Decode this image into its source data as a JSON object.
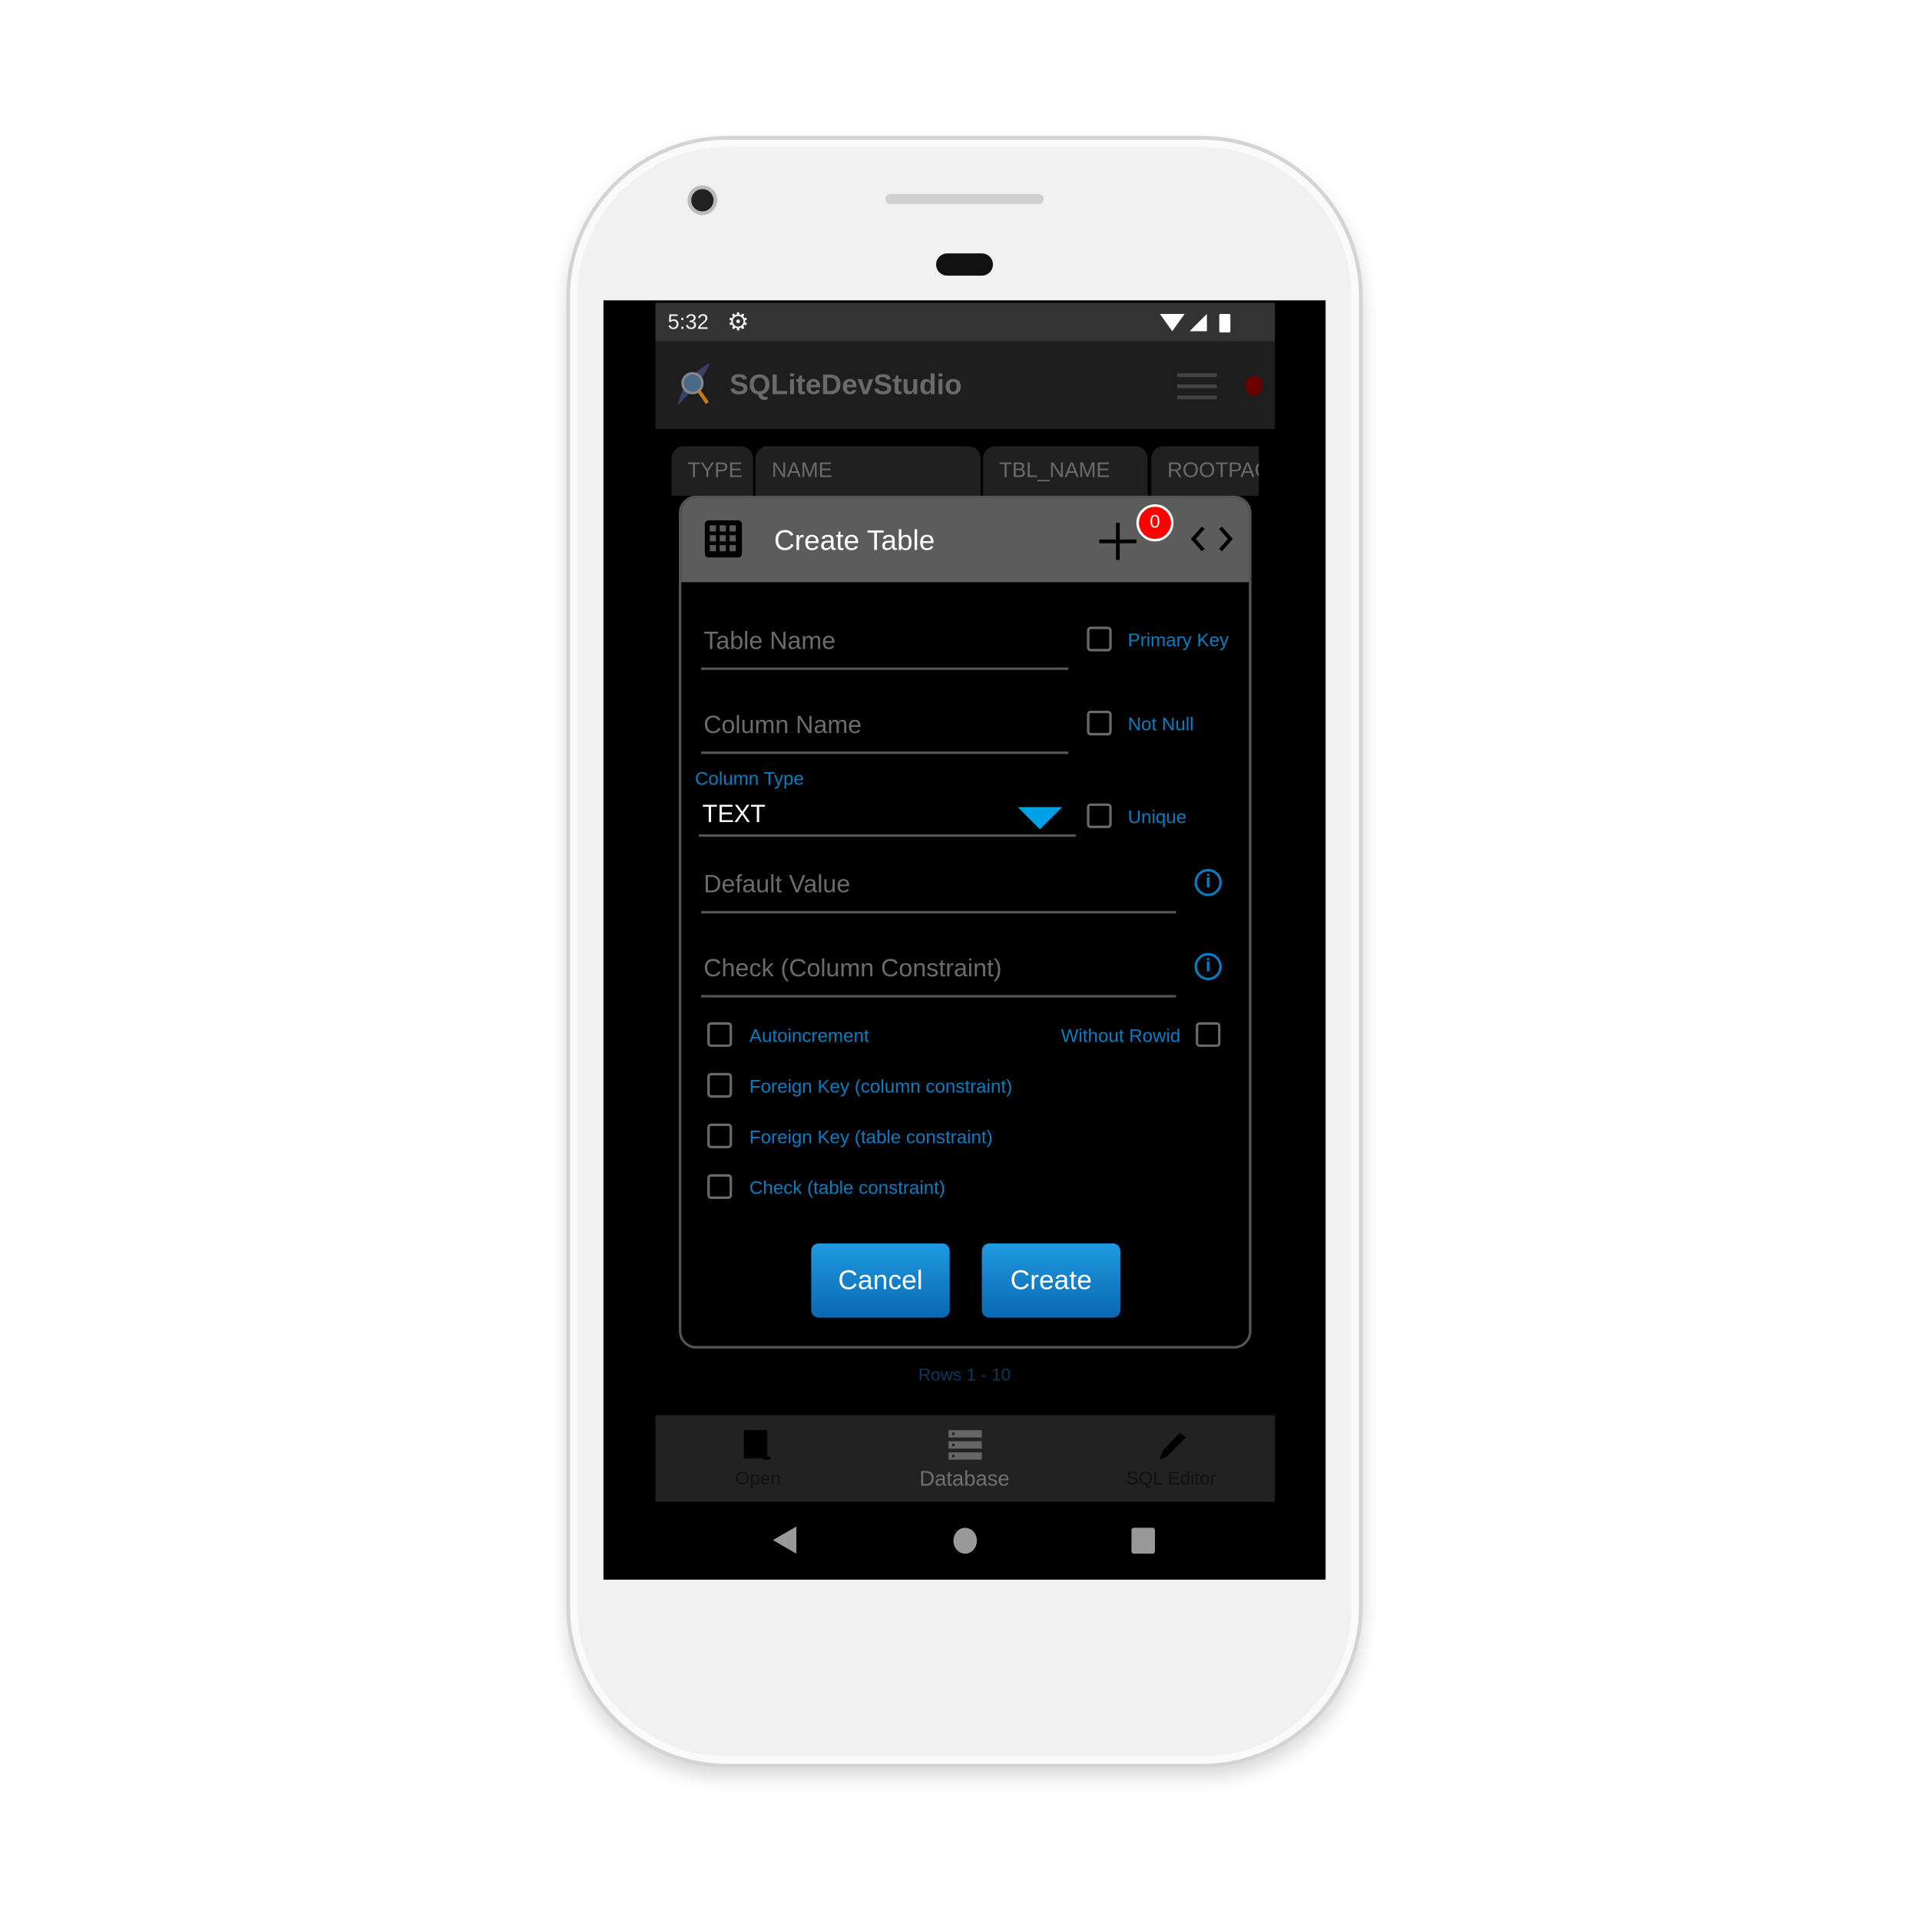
{
  "status_bar": {
    "time": "5:32",
    "icons": [
      "gear-icon",
      "wifi-icon",
      "signal-icon",
      "battery-icon"
    ]
  },
  "app_bar": {
    "title": "SQLiteDevStudio",
    "menu_icon": "hamburger-icon"
  },
  "table_columns": [
    "TYPE",
    "NAME",
    "TBL_NAME",
    "ROOTPAG"
  ],
  "dialog": {
    "title": "Create Table",
    "badge_count": "0",
    "fields": {
      "table_name_placeholder": "Table Name",
      "column_name_placeholder": "Column Name",
      "column_type_label": "Column Type",
      "column_type_value": "TEXT",
      "default_value_placeholder": "Default Value",
      "check_placeholder": "Check (Column Constraint)"
    },
    "checkboxes": {
      "primary_key": "Primary Key",
      "not_null": "Not Null",
      "unique": "Unique",
      "autoincrement": "Autoincrement",
      "without_rowid": "Without Rowid",
      "fk_column": "Foreign Key (column constraint)",
      "fk_table": "Foreign Key (table constraint)",
      "check_table": "Check (table constraint)"
    },
    "cancel_label": "Cancel",
    "create_label": "Create"
  },
  "rows_label": "Rows 1 - 10",
  "bottom_nav": [
    {
      "label": "Open",
      "icon": "door-icon"
    },
    {
      "label": "Database",
      "icon": "database-icon",
      "active": true
    },
    {
      "label": "SQL Editor",
      "icon": "pencil-icon"
    }
  ],
  "colors": {
    "accent": "#0a7cc0",
    "button": "#1a86d0",
    "badge": "#ff0000",
    "dropdown_arrow": "#00a0e9"
  }
}
